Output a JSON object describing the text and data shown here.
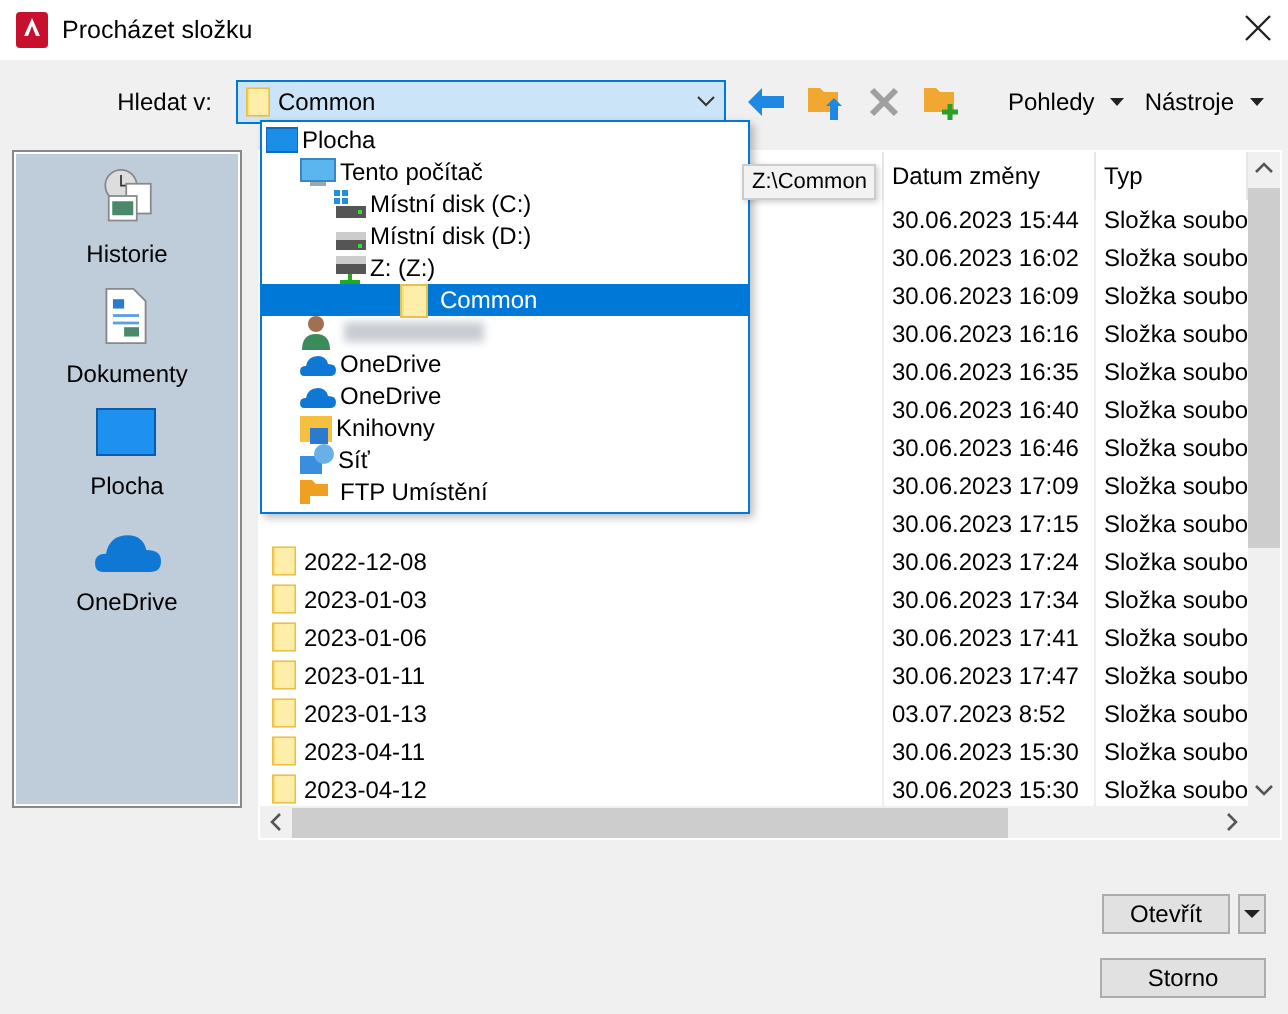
{
  "window": {
    "title": "Procházet složku"
  },
  "toolbar": {
    "look_in_label": "Hledat v:",
    "look_in": "Common",
    "delete_disabled": true,
    "views": "Pohledy",
    "tools": "Nástroje"
  },
  "places": [
    {
      "label": "Historie",
      "kind": "history"
    },
    {
      "label": "Dokumenty",
      "kind": "documents"
    },
    {
      "label": "Plocha",
      "kind": "desktop"
    },
    {
      "label": "OneDrive",
      "kind": "onedrive"
    }
  ],
  "dropdown": {
    "items": [
      {
        "label": "Plocha",
        "kind": "desktop",
        "selected": false,
        "children": [
          {
            "label": "Tento počítač",
            "kind": "computer",
            "selected": false,
            "children": [
              {
                "label": "Místní disk (C:)",
                "kind": "system-drive",
                "selected": false
              },
              {
                "label": "Místní disk (D:)",
                "kind": "drive",
                "selected": false
              },
              {
                "label": "Z: (Z:)",
                "kind": "network-drive",
                "selected": false,
                "children": [
                  {
                    "label": "Common",
                    "kind": "folder",
                    "selected": true
                  }
                ]
              }
            ]
          },
          {
            "kind": "user",
            "selected": false
          },
          {
            "label": "OneDrive",
            "kind": "onedrive",
            "selected": false
          },
          {
            "label": "OneDrive",
            "kind": "onedrive",
            "selected": false
          },
          {
            "label": "Knihovny",
            "kind": "library",
            "selected": false
          },
          {
            "label": "Síť",
            "kind": "network",
            "selected": false
          },
          {
            "label": "FTP Umístění",
            "kind": "ftp",
            "selected": false
          }
        ]
      }
    ]
  },
  "tooltip": "Z:\\Common",
  "file_list": {
    "columns": [
      "Datum změny",
      "Typ"
    ],
    "rows": [
      {
        "date": "30.06.2023 15:44",
        "type": "Složka soubo"
      },
      {
        "date": "30.06.2023 16:02",
        "type": "Složka soubo"
      },
      {
        "date": "30.06.2023 16:09",
        "type": "Složka soubo"
      },
      {
        "date": "30.06.2023 16:16",
        "type": "Složka soubo"
      },
      {
        "date": "30.06.2023 16:35",
        "type": "Složka soubo"
      },
      {
        "date": "30.06.2023 16:40",
        "type": "Složka soubo"
      },
      {
        "date": "30.06.2023 16:46",
        "type": "Složka soubo"
      },
      {
        "date": "30.06.2023 17:09",
        "type": "Složka soubo"
      },
      {
        "date": "30.06.2023 17:15",
        "type": "Složka soubo"
      },
      {
        "name": "2022-12-08",
        "date": "30.06.2023 17:24",
        "type": "Složka soubo"
      },
      {
        "name": "2023-01-03",
        "date": "30.06.2023 17:34",
        "type": "Složka soubo"
      },
      {
        "name": "2023-01-06",
        "date": "30.06.2023 17:41",
        "type": "Složka soubo"
      },
      {
        "name": "2023-01-11",
        "date": "30.06.2023 17:47",
        "type": "Složka soubo"
      },
      {
        "name": "2023-01-13",
        "date": "03.07.2023 8:52",
        "type": "Složka soubo"
      },
      {
        "name": "2023-04-11",
        "date": "30.06.2023 15:30",
        "type": "Složka soubo"
      },
      {
        "name": "2023-04-12",
        "date": "30.06.2023 15:30",
        "type": "Složka soubo"
      }
    ]
  },
  "buttons": {
    "open": "Otevřít",
    "cancel": "Storno"
  }
}
